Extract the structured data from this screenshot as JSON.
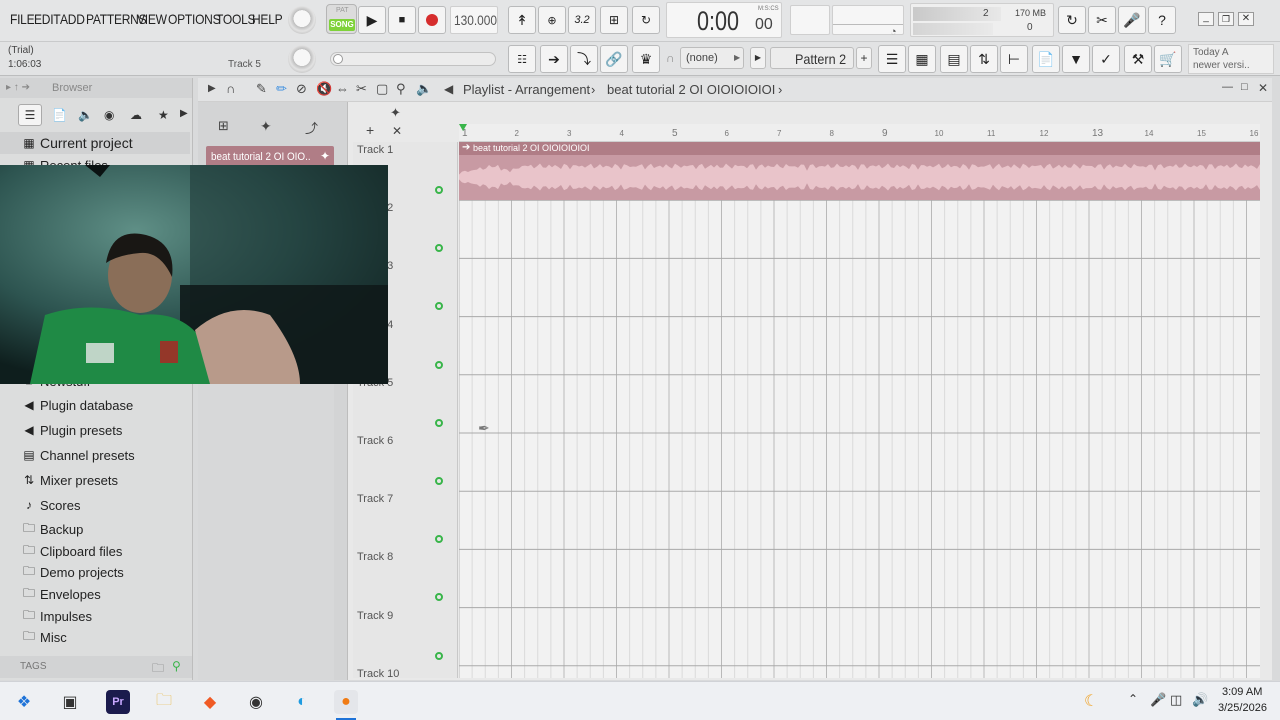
{
  "menu": [
    "FILE",
    "EDIT",
    "ADD",
    "PATTERNS",
    "VIEW",
    "OPTIONS",
    "TOOLS",
    "HELP"
  ],
  "transport": {
    "pat_label": "PAT",
    "song_label": "SONG",
    "tempo": "130.000",
    "time": "0:00",
    "time_small": "00",
    "time_units": "M:S:CS"
  },
  "meters": {
    "cpu_value": "2",
    "memory": "170 MB",
    "poly": "0"
  },
  "hint": {
    "line1": "(Trial)",
    "line2": "1:06:03",
    "track": "Track 5"
  },
  "toolbar2": {
    "none_label": "(none)",
    "pattern_label": "Pattern 2",
    "news_line1": "Today  A",
    "news_line2": "newer versi.."
  },
  "browser": {
    "title": "Browser",
    "items": [
      {
        "label": "Current project",
        "icon": "project-icon"
      },
      {
        "label": "Recent files",
        "icon": "recent-icon"
      },
      {
        "label": "Newstuff",
        "icon": "folder-icon"
      },
      {
        "label": "Plugin database",
        "icon": "plugin-icon"
      },
      {
        "label": "Plugin presets",
        "icon": "plugin-icon"
      },
      {
        "label": "Channel presets",
        "icon": "channel-icon"
      },
      {
        "label": "Mixer presets",
        "icon": "mixer-icon"
      },
      {
        "label": "Scores",
        "icon": "note-icon"
      },
      {
        "label": "Backup",
        "icon": "folder-icon"
      },
      {
        "label": "Clipboard files",
        "icon": "folder-icon"
      },
      {
        "label": "Demo projects",
        "icon": "folder-icon"
      },
      {
        "label": "Envelopes",
        "icon": "folder-icon"
      },
      {
        "label": "Impulses",
        "icon": "folder-icon"
      },
      {
        "label": "Misc",
        "icon": "folder-icon"
      }
    ],
    "tags_label": "TAGS"
  },
  "playlist": {
    "title": "Playlist - Arrangement",
    "arrangement": "beat tutorial 2 OI OIOIOIOIOI",
    "clip_selector": "beat tutorial 2 OI OIO..",
    "clip_name": "beat tutorial 2 OI OIOIOIOIOI",
    "ruler": [
      "1",
      "2",
      "3",
      "4",
      "5",
      "6",
      "7",
      "8",
      "9",
      "10",
      "11",
      "12",
      "13",
      "14",
      "15",
      "16"
    ],
    "tracks": [
      "Track 1",
      "Track 2",
      "Track 3",
      "Track 4",
      "Track 5",
      "Track 6",
      "Track 7",
      "Track 8",
      "Track 9",
      "Track 10"
    ]
  },
  "taskbar": {
    "time": "3:09 AM",
    "date": "3/25/2026"
  },
  "colors": {
    "clip_header": "#b07d86",
    "clip_body": "#c89aa3",
    "wave": "#e9c4ca",
    "accent_green": "#39b54a",
    "record_red": "#d62d2d"
  }
}
